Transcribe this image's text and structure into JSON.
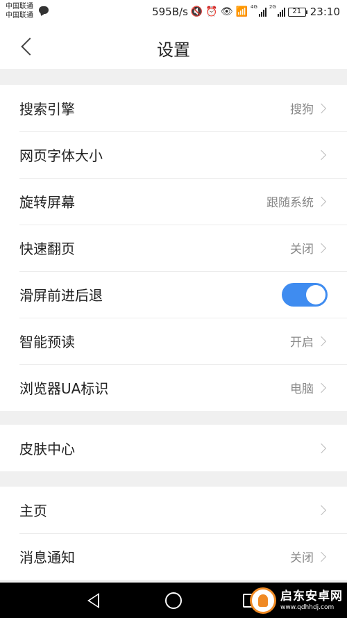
{
  "status_bar": {
    "carrier_1": "中国联通",
    "carrier_2": "中国联通",
    "speed": "595B/s",
    "net_1": "4G",
    "net_2": "2G",
    "battery": "21",
    "time": "23:10"
  },
  "header": {
    "title": "设置"
  },
  "group_1": {
    "items": [
      {
        "label": "搜索引擎",
        "value": "搜狗"
      },
      {
        "label": "网页字体大小",
        "value": ""
      },
      {
        "label": "旋转屏幕",
        "value": "跟随系统"
      },
      {
        "label": "快速翻页",
        "value": "关闭"
      },
      {
        "label": "滑屏前进后退",
        "toggle_on": true
      },
      {
        "label": "智能预读",
        "value": "开启"
      },
      {
        "label": "浏览器UA标识",
        "value": "电脑"
      }
    ]
  },
  "group_2": {
    "items": [
      {
        "label": "皮肤中心",
        "value": ""
      }
    ]
  },
  "group_3": {
    "items": [
      {
        "label": "主页",
        "value": ""
      },
      {
        "label": "消息通知",
        "value": "关闭"
      }
    ]
  },
  "watermark": {
    "name": "启东安卓网",
    "url": "www.qdhhdj.com"
  },
  "colors": {
    "accent": "#3f8cf0",
    "background": "#f0f0f0",
    "watermark": "#f08a24"
  }
}
